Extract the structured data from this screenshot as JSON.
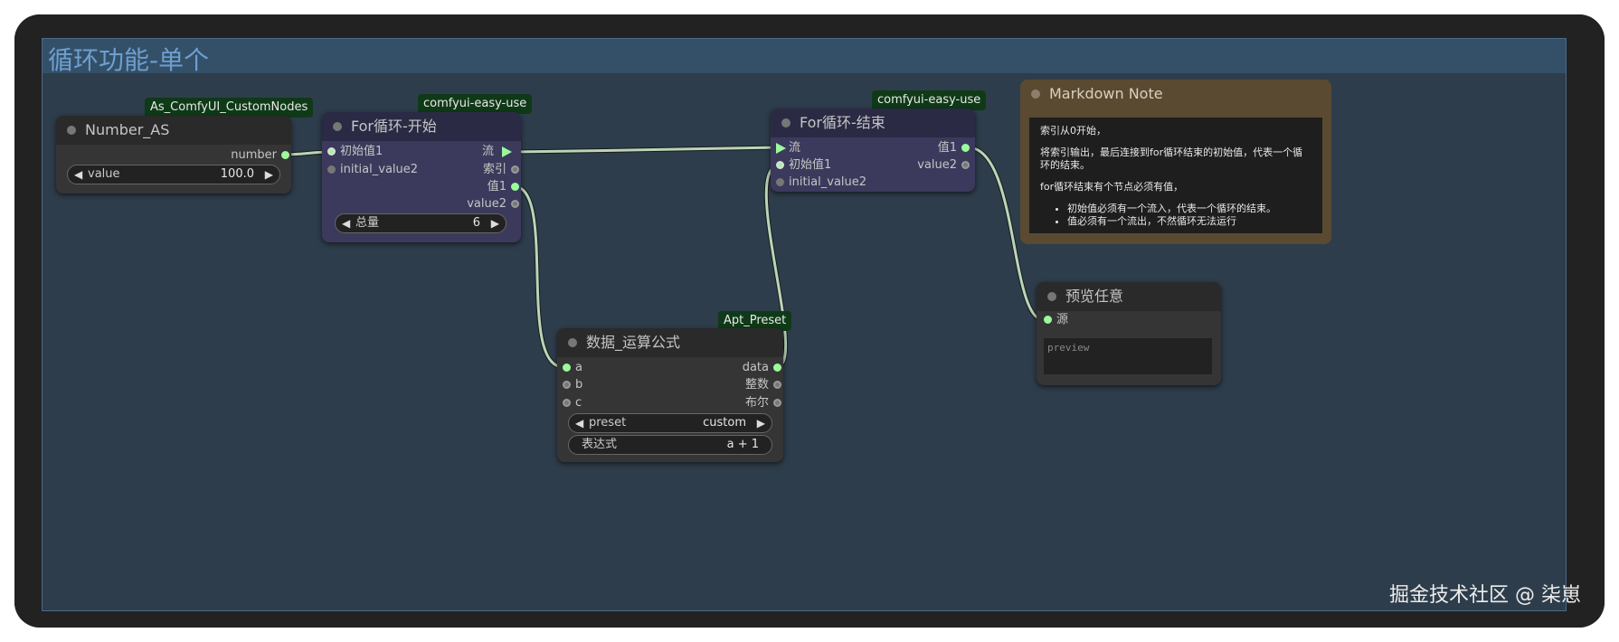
{
  "group_title": "循环功能-单个",
  "nodes": {
    "number_as": {
      "badge": "As_ComfyUI_CustomNodes",
      "title": "Number_AS",
      "output": "number",
      "widget_label": "value",
      "widget_value": "100.0"
    },
    "for_start": {
      "badge": "comfyui-easy-use",
      "title": "For循环-开始",
      "inputs": [
        "初始值1",
        "initial_value2"
      ],
      "outputs": [
        "流",
        "索引",
        "值1",
        "value2"
      ],
      "widget_label": "总量",
      "widget_value": "6"
    },
    "for_end": {
      "badge": "comfyui-easy-use",
      "title": "For循环-结束",
      "inputs": [
        "流",
        "初始值1",
        "initial_value2"
      ],
      "outputs": [
        "值1",
        "value2"
      ]
    },
    "formula": {
      "badge": "Apt_Preset",
      "title": "数据_运算公式",
      "inputs": [
        "a",
        "b",
        "c"
      ],
      "outputs": [
        "data",
        "整数",
        "布尔"
      ],
      "preset_label": "preset",
      "preset_value": "custom",
      "expr_label": "表达式",
      "expr_value": "a + 1"
    },
    "markdown": {
      "title": "Markdown Note",
      "lines": [
        "索引从0开始，",
        "将索引输出，最后连接到for循环结束的初始值，代表一个循环的结束。",
        "for循环结束有个节点必须有值，"
      ],
      "bullets": [
        "初始值必须有一个流入，代表一个循环的结束。",
        "值必须有一个流出，不然循环无法运行"
      ]
    },
    "preview": {
      "title": "预览任意",
      "input": "源",
      "placeholder": "preview"
    }
  },
  "watermark": "掘金技术社区 @ 柒崽",
  "colors": {
    "wire": "#b9d5b9",
    "slot_on": "#9bfa9b",
    "group_bg": "#2e3d4b",
    "badge_bg": "#0f3a17"
  }
}
